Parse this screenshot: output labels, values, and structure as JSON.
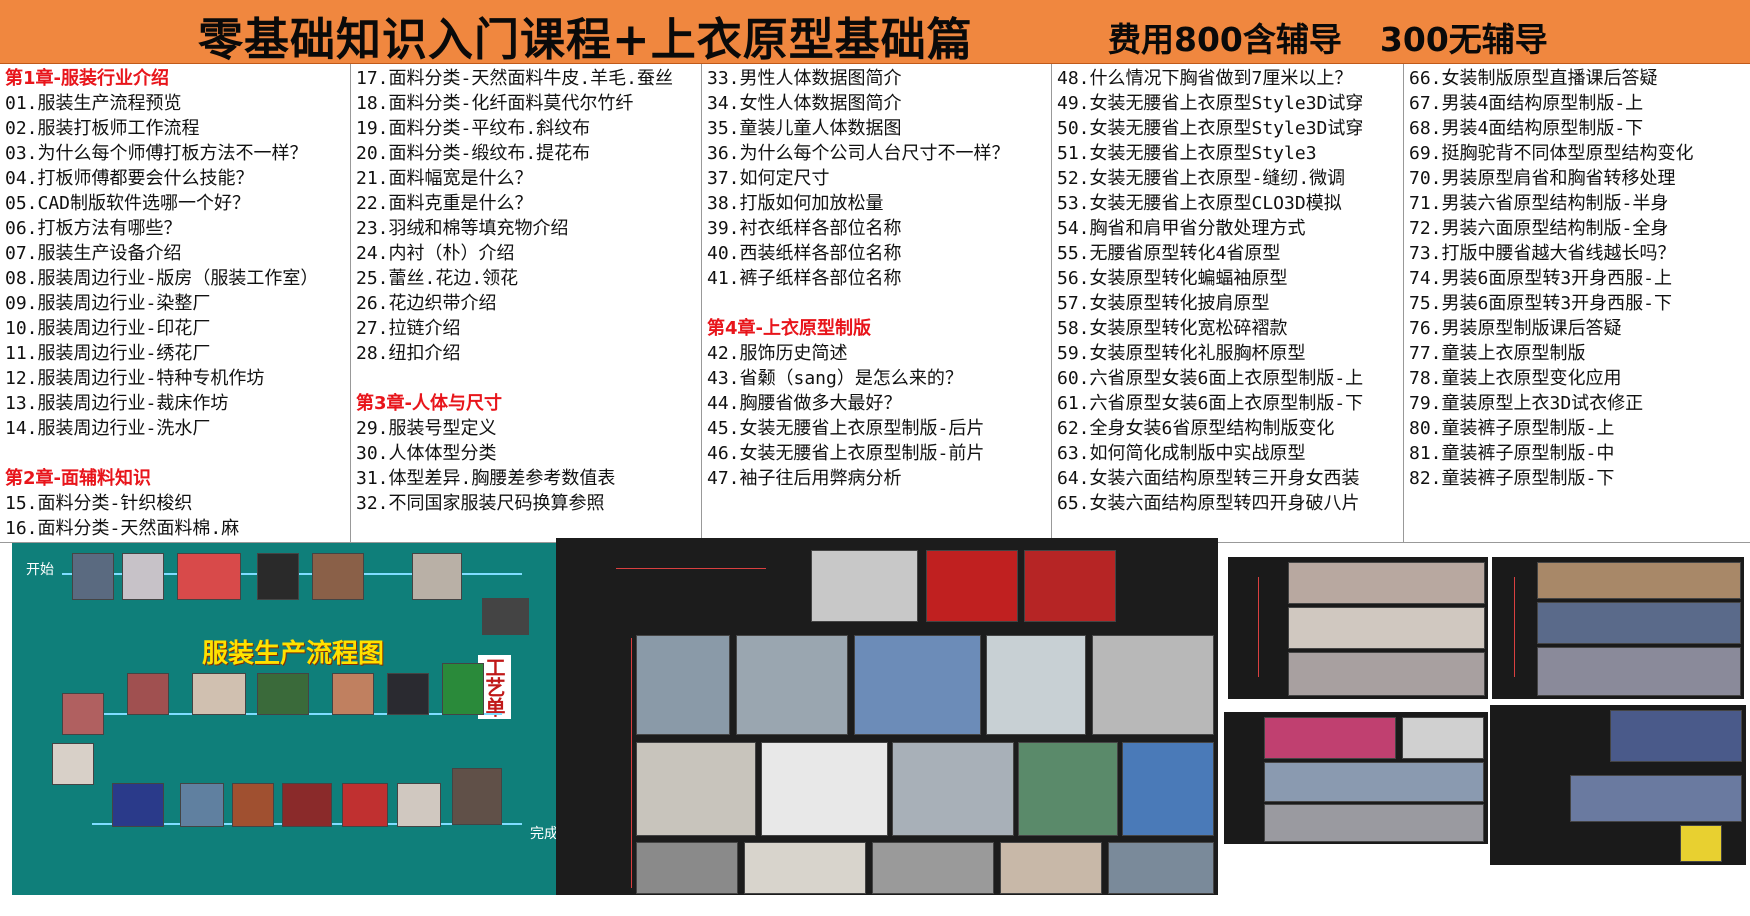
{
  "header": {
    "title": "零基础知识入门课程+上衣原型基础篇",
    "fee_with": "费用800含辅导",
    "fee_without": "300无辅导"
  },
  "columns": [
    [
      {
        "t": "第1章-服装行业介绍",
        "chap": true
      },
      {
        "t": "01.服装生产流程预览"
      },
      {
        "t": "02.服装打板师工作流程"
      },
      {
        "t": "03.为什么每个师傅打板方法不一样？"
      },
      {
        "t": "04.打板师傅都要会什么技能？"
      },
      {
        "t": "05.CAD制版软件选哪一个好？"
      },
      {
        "t": "06.打板方法有哪些？"
      },
      {
        "t": "07.服装生产设备介绍"
      },
      {
        "t": "08.服装周边行业-版房（服装工作室）"
      },
      {
        "t": "09.服装周边行业-染整厂"
      },
      {
        "t": "10.服装周边行业-印花厂"
      },
      {
        "t": "11.服装周边行业-绣花厂"
      },
      {
        "t": "12.服装周边行业-特种专机作坊"
      },
      {
        "t": "13.服装周边行业-裁床作坊"
      },
      {
        "t": "14.服装周边行业-洗水厂"
      },
      {
        "t": ""
      },
      {
        "t": "第2章-面辅料知识",
        "chap": true
      },
      {
        "t": "15.面料分类-针织梭织"
      },
      {
        "t": "16.面料分类-天然面料棉.麻"
      }
    ],
    [
      {
        "t": "17.面料分类-天然面料牛皮.羊毛.蚕丝"
      },
      {
        "t": "18.面料分类-化纤面料莫代尔竹纤"
      },
      {
        "t": "19.面料分类-平纹布.斜纹布"
      },
      {
        "t": "20.面料分类-缎纹布.提花布"
      },
      {
        "t": "21.面料幅宽是什么？"
      },
      {
        "t": "22.面料克重是什么？"
      },
      {
        "t": "23.羽绒和棉等填充物介绍"
      },
      {
        "t": "24.内衬（朴）介绍"
      },
      {
        "t": "25.蕾丝.花边.领花"
      },
      {
        "t": "26.花边织带介绍"
      },
      {
        "t": "27.拉链介绍"
      },
      {
        "t": "28.纽扣介绍"
      },
      {
        "t": ""
      },
      {
        "t": "第3章-人体与尺寸",
        "chap": true
      },
      {
        "t": "29.服装号型定义"
      },
      {
        "t": "30.人体体型分类"
      },
      {
        "t": "31.体型差异.胸腰差参考数值表"
      },
      {
        "t": "32.不同国家服装尺码换算参照"
      }
    ],
    [
      {
        "t": "33.男性人体数据图简介"
      },
      {
        "t": "34.女性人体数据图简介"
      },
      {
        "t": "35.童装儿童人体数据图"
      },
      {
        "t": "36.为什么每个公司人台尺寸不一样？"
      },
      {
        "t": "37.如何定尺寸"
      },
      {
        "t": "38.打版如何加放松量"
      },
      {
        "t": "39.衬衣纸样各部位名称"
      },
      {
        "t": "40.西装纸样各部位名称"
      },
      {
        "t": "41.裤子纸样各部位名称"
      },
      {
        "t": ""
      },
      {
        "t": "第4章-上衣原型制版",
        "chap": true
      },
      {
        "t": "42.服饰历史简述"
      },
      {
        "t": "43.省颡（sang）是怎么来的？"
      },
      {
        "t": "44.胸腰省做多大最好？"
      },
      {
        "t": "45.女装无腰省上衣原型制版-后片"
      },
      {
        "t": "46.女装无腰省上衣原型制版-前片"
      },
      {
        "t": "47.袖子往后用弊病分析"
      }
    ],
    [
      {
        "t": "48.什么情况下胸省做到7厘米以上？"
      },
      {
        "t": "49.女装无腰省上衣原型Style3D试穿"
      },
      {
        "t": "50.女装无腰省上衣原型Style3D试穿"
      },
      {
        "t": "51.女装无腰省上衣原型Style3"
      },
      {
        "t": "52.女装无腰省上衣原型-缝纫.微调"
      },
      {
        "t": "53.女装无腰省上衣原型CLO3D模拟"
      },
      {
        "t": "54.胸省和肩甲省分散处理方式"
      },
      {
        "t": "55.无腰省原型转化4省原型"
      },
      {
        "t": "56.女装原型转化蝙蝠袖原型"
      },
      {
        "t": "57.女装原型转化披肩原型"
      },
      {
        "t": "58.女装原型转化宽松碎褶款"
      },
      {
        "t": "59.女装原型转化礼服胸杯原型"
      },
      {
        "t": "60.六省原型女装6面上衣原型制版-上"
      },
      {
        "t": "61.六省原型女装6面上衣原型制版-下"
      },
      {
        "t": "62.全身女装6省原型结构制版变化"
      },
      {
        "t": "63.如何简化成制版中实战原型"
      },
      {
        "t": "64.女装六面结构原型转三开身女西装"
      },
      {
        "t": "65.女装六面结构原型转四开身破八片"
      }
    ],
    [
      {
        "t": "66.女装制版原型直播课后答疑"
      },
      {
        "t": "67.男装4面结构原型制版-上"
      },
      {
        "t": "68.男装4面结构原型制版-下"
      },
      {
        "t": "69.挺胸驼背不同体型原型结构变化"
      },
      {
        "t": "70.男装原型肩省和胸省转移处理"
      },
      {
        "t": "71.男装六省原型结构制版-半身"
      },
      {
        "t": "72.男装六面原型结构制版-全身"
      },
      {
        "t": "73.打版中腰省越大省线越长吗？"
      },
      {
        "t": "74.男装6面原型转3开身西服-上"
      },
      {
        "t": "75.男装6面原型转3开身西服-下"
      },
      {
        "t": "76.男装原型制版课后答疑"
      },
      {
        "t": "77.童装上衣原型制版"
      },
      {
        "t": "78.童装上衣原型变化应用"
      },
      {
        "t": "79.童装原型上衣3D试衣修正"
      },
      {
        "t": "80.童装裤子原型制版-上"
      },
      {
        "t": "81.童装裤子原型制版-中"
      },
      {
        "t": "82.童装裤子原型制版-下"
      }
    ]
  ],
  "flowchart": {
    "title": "服装生产流程图",
    "start": "开始",
    "end": "完成",
    "craft_sheet": "工艺单"
  },
  "colors": {
    "header_bg": "#f0873f",
    "chapter_red": "#e8151b",
    "flow_bg": "#0f7f7a",
    "dark_bg": "#1c1c1c"
  }
}
